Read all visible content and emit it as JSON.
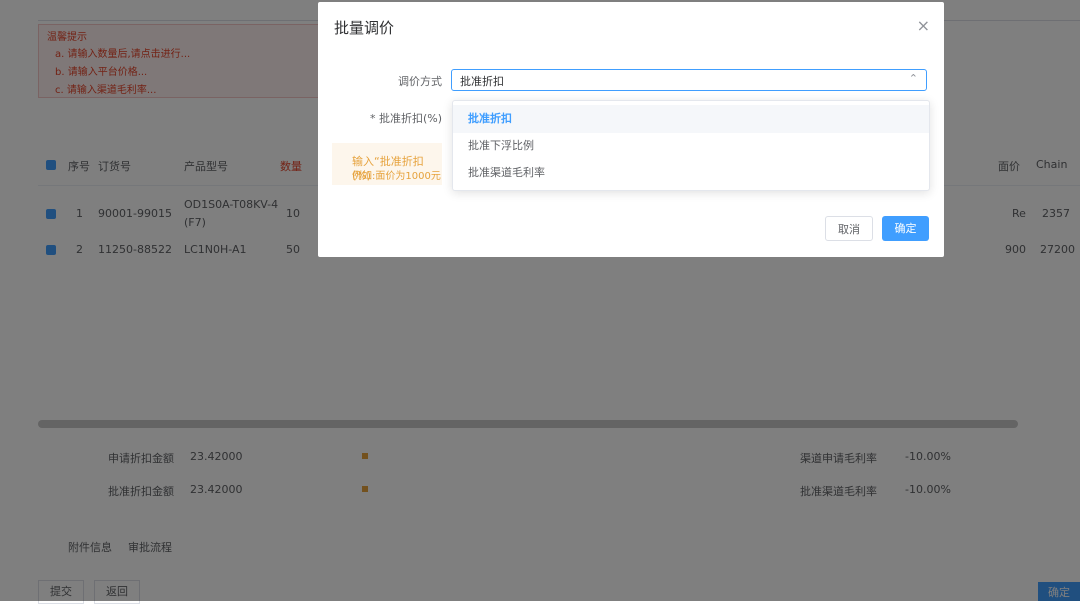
{
  "dialog": {
    "title": "批量调价",
    "close_glyph": "×",
    "price_method_label": "调价方式",
    "price_method_value": "批准折扣",
    "discount_label": "* 批准折扣(%)",
    "tip_line1": "输入“批准折扣(%)",
    "tip_line2": "例如:面价为1000元",
    "cancel_label": "取消",
    "confirm_label": "确定"
  },
  "dropdown": {
    "options": [
      {
        "label": "批准折扣",
        "selected": true
      },
      {
        "label": "批准下浮比例",
        "selected": false
      },
      {
        "label": "批准渠道毛利率",
        "selected": false
      }
    ]
  },
  "background": {
    "notice_title": "温馨提示",
    "notice_lines": [
      "a. 请输入数量后,请点击进行...",
      "b. 请输入平台价格...",
      "c. 请输入渠道毛利率..."
    ],
    "table_headers": [
      "序号",
      "订货号",
      "产品型号",
      "数量"
    ],
    "rows": [
      {
        "index": "1",
        "order_no": "90001-99015",
        "model": "OD1S0A-T08KV-4",
        "model2": "(F7)",
        "qty": "10",
        "tail1": "Re",
        "tail2": "2357"
      },
      {
        "index": "2",
        "order_no": "11250-88522",
        "model": "LC1N0H-A1",
        "qty": "50",
        "tail1": "900",
        "tail2": "27200"
      }
    ],
    "right_headers": [
      "面价",
      "Chain"
    ],
    "summary": [
      {
        "label": "申请折扣金额",
        "value": "23.42000"
      },
      {
        "label": "批准折扣金额",
        "value": "23.42000"
      }
    ],
    "summary_right": [
      {
        "label": "渠道申请毛利率",
        "value": "-10.00%"
      },
      {
        "label": "批准渠道毛利率",
        "value": "-10.00%"
      }
    ],
    "bottom_links": [
      "附件信息",
      "审批流程"
    ],
    "bottom_buttons": [
      "提交",
      "返回"
    ],
    "submit_label": "确定"
  }
}
